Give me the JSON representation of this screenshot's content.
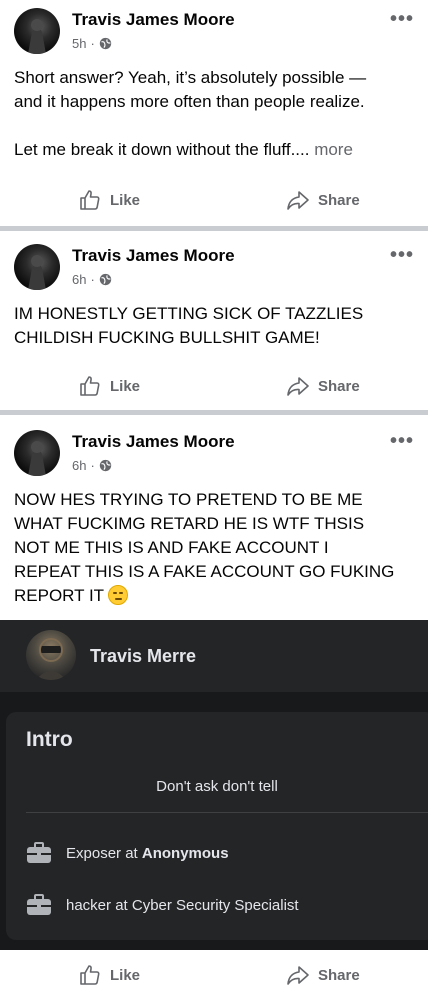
{
  "posts": [
    {
      "author": "Travis James Moore",
      "time": "5h",
      "text_line1": "Short answer? Yeah, it’s absolutely possible —",
      "text_line2": "and it happens more often than people realize.",
      "text_line3": "Let me break it down without the fluff.... ",
      "more": "more"
    },
    {
      "author": "Travis James Moore",
      "time": "6h",
      "text_line1": "IM HONESTLY GETTING SICK OF TAZZLIES",
      "text_line2": "CHILDISH FUCKING BULLSHIT GAME!"
    },
    {
      "author": "Travis James Moore",
      "time": "6h",
      "text_line1": "NOW HES TRYING TO PRETEND TO BE ME",
      "text_line2": "WHAT FUCKIMG RETARD HE IS WTF THSIS",
      "text_line3": "NOT ME THIS IS AND FAKE ACCOUNT I",
      "text_line4": "REPEAT THIS IS A FAKE ACCOUNT GO FUKING",
      "text_line5": "REPORT IT "
    }
  ],
  "actions": {
    "like": "Like",
    "share": "Share"
  },
  "meta_separator": "·",
  "embedded_profile": {
    "name": "Travis Merre",
    "intro_title": "Intro",
    "bio": "Don't ask don't tell",
    "work": [
      {
        "role": "Exposer at ",
        "org": "Anonymous"
      },
      {
        "role": "hacker at Cyber Security Specialist",
        "org": ""
      }
    ]
  },
  "colors": {
    "text": "#050505",
    "secondary": "#65676b",
    "divider": "#c9ccd1",
    "dark_bg": "#18191a",
    "dark_card": "#242526"
  }
}
